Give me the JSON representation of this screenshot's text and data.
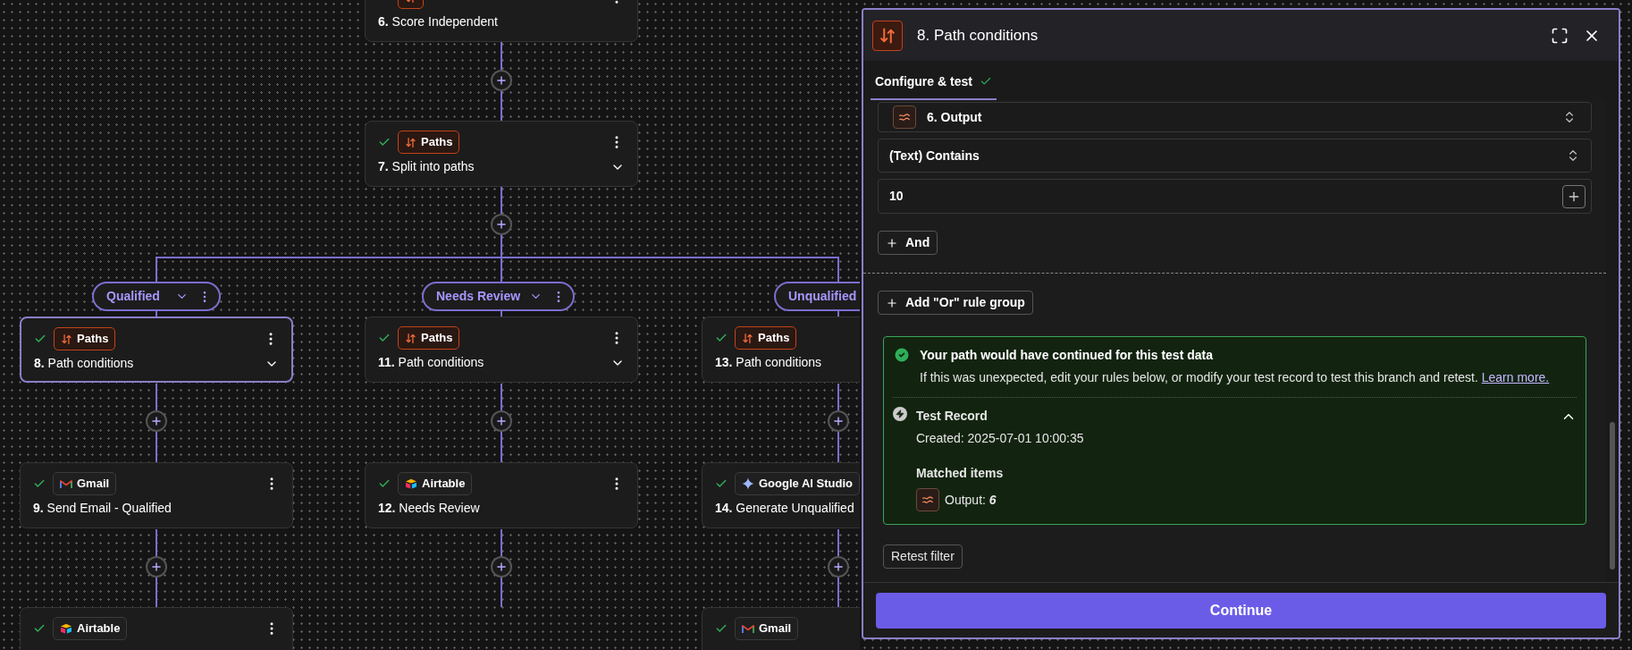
{
  "canvas": {
    "trunk": [
      {
        "app": {
          "kind": "paths"
        },
        "number": "6.",
        "title": "Score Independent",
        "selected": false,
        "expandable": false
      },
      {
        "app": {
          "kind": "paths",
          "label": "Paths"
        },
        "number": "7.",
        "title": "Split into paths",
        "checked": true,
        "selected": false,
        "expandable": true
      }
    ],
    "branches": [
      {
        "label": "Qualified",
        "nodes": [
          {
            "app": {
              "kind": "paths",
              "label": "Paths"
            },
            "number": "8.",
            "title": "Path conditions",
            "checked": true,
            "selected": true,
            "expandable": true
          },
          {
            "app": {
              "kind": "gmail",
              "label": "Gmail"
            },
            "number": "9.",
            "title": "Send Email - Qualified",
            "checked": true,
            "selected": false,
            "expandable": false
          },
          {
            "app": {
              "kind": "airtable",
              "label": "Airtable"
            },
            "checked": true,
            "selected": false
          }
        ]
      },
      {
        "label": "Needs Review",
        "nodes": [
          {
            "app": {
              "kind": "paths",
              "label": "Paths"
            },
            "number": "11.",
            "title": "Path conditions",
            "checked": true,
            "selected": false,
            "expandable": true
          },
          {
            "app": {
              "kind": "airtable",
              "label": "Airtable"
            },
            "number": "12.",
            "title": "Needs Review",
            "checked": true,
            "selected": false,
            "expandable": false
          }
        ]
      },
      {
        "label": "Unqualified",
        "nodes": [
          {
            "app": {
              "kind": "paths",
              "label": "Paths"
            },
            "number": "13.",
            "title": "Path conditions",
            "checked": true,
            "selected": false,
            "expandable": false
          },
          {
            "app": {
              "kind": "ai",
              "label": "Google AI Studio"
            },
            "number": "14.",
            "title": "Generate Unqualified",
            "checked": true,
            "selected": false,
            "expandable": false
          },
          {
            "app": {
              "kind": "gmail",
              "label": "Gmail"
            },
            "checked": true,
            "selected": false
          }
        ]
      }
    ]
  },
  "panel": {
    "number": "8.",
    "title": "Path conditions",
    "tabs": [
      {
        "label": "Configure & test",
        "selected": true,
        "done": true
      }
    ],
    "rules": [
      {
        "kind": "step_select",
        "value": "6. Output"
      },
      {
        "kind": "select",
        "value": "(Text) Contains"
      },
      {
        "kind": "text",
        "value": "10"
      }
    ],
    "and_button": "And",
    "or_button": "Add \"Or\" rule group",
    "result": {
      "title": "Your path would have continued for this test data",
      "text": "If this was unexpected, edit your rules below, or modify your test record to test this branch and retest.",
      "link": "Learn more.",
      "record": {
        "title": "Test Record",
        "created": "Created: 2025-07-01 10:00:35",
        "expanded": true
      },
      "matched_title": "Matched items",
      "matched": [
        {
          "label": "Output:",
          "value": "6"
        }
      ]
    },
    "retest": "Retest filter",
    "continue": "Continue"
  }
}
